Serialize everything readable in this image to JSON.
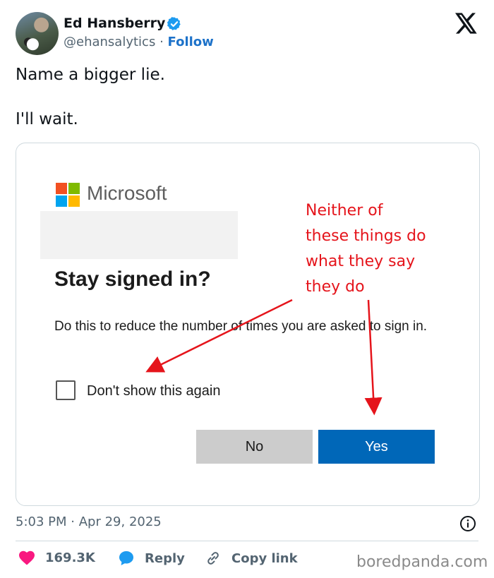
{
  "author": {
    "name": "Ed Hansberry",
    "handle": "@ehansalytics",
    "separator": "·",
    "follow_label": "Follow"
  },
  "tweet": {
    "lines": [
      "Name a bigger lie.",
      "I'll wait."
    ]
  },
  "media": {
    "brand": "Microsoft",
    "dialog_title": "Stay signed in?",
    "dialog_body": "Do this to reduce the number of times you are asked to sign in.",
    "checkbox_label": "Don't show this again",
    "checkbox_checked": false,
    "no_label": "No",
    "yes_label": "Yes",
    "annotation_lines": [
      "Neither of",
      "these things do",
      "what they say",
      "they do"
    ],
    "annotation_color": "#e5141b",
    "yes_color": "#0067b8",
    "no_color": "#cccccc"
  },
  "footer": {
    "time": "5:03 PM",
    "separator": "·",
    "date": "Apr 29, 2025",
    "likes": "169.3K",
    "reply_label": "Reply",
    "copy_label": "Copy link",
    "watermark": "boredpanda.com"
  },
  "colors": {
    "accent": "#1d72c9",
    "like": "#f91880",
    "verified": "#1d9bf0"
  }
}
